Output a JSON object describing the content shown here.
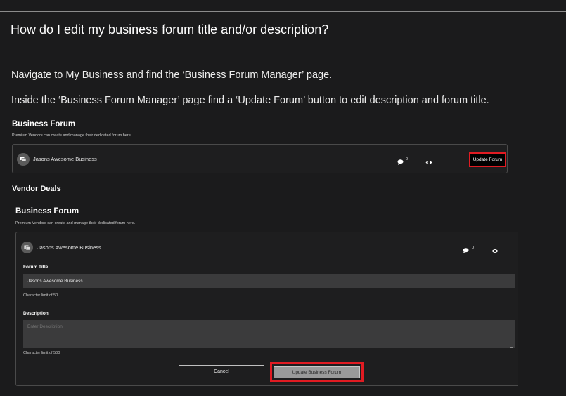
{
  "faq": {
    "title": "How do I edit my business forum title and/or description?",
    "paragraph1": "Navigate to My Business and find the ‘Business Forum Manager’ page.",
    "paragraph2": "Inside the ‘Business Forum Manager’ page find a ‘Update Forum’ button to edit description and forum title."
  },
  "screenshot1": {
    "heading": "Business Forum",
    "subheading": "Premium Vendors can create and manage their dedicated forum here.",
    "forum_name": "Jasons Awesome Business",
    "comment_count": "0",
    "update_button": "Update Forum",
    "cut_heading": "Vendor Deals"
  },
  "screenshot2": {
    "heading": "Business Forum",
    "subheading": "Premium Vendors can create and manage their dedicated forum here.",
    "forum_name": "Jasons Awesome Business",
    "comment_count": "0",
    "title_label": "Forum Title",
    "title_value": "Jasons Awesome Business",
    "title_hint": "Character limit of 50",
    "desc_label": "Description",
    "desc_placeholder": "Enter Description",
    "desc_hint": "Character limit of 500",
    "cancel_button": "Cancel",
    "update_button": "Update Business Forum"
  },
  "colors": {
    "background": "#1b1b1c",
    "highlight": "#e11b22",
    "input_bg": "#3b3b3c"
  },
  "icons": [
    "forum-avatar-icon",
    "comment-icon",
    "eye-icon"
  ]
}
